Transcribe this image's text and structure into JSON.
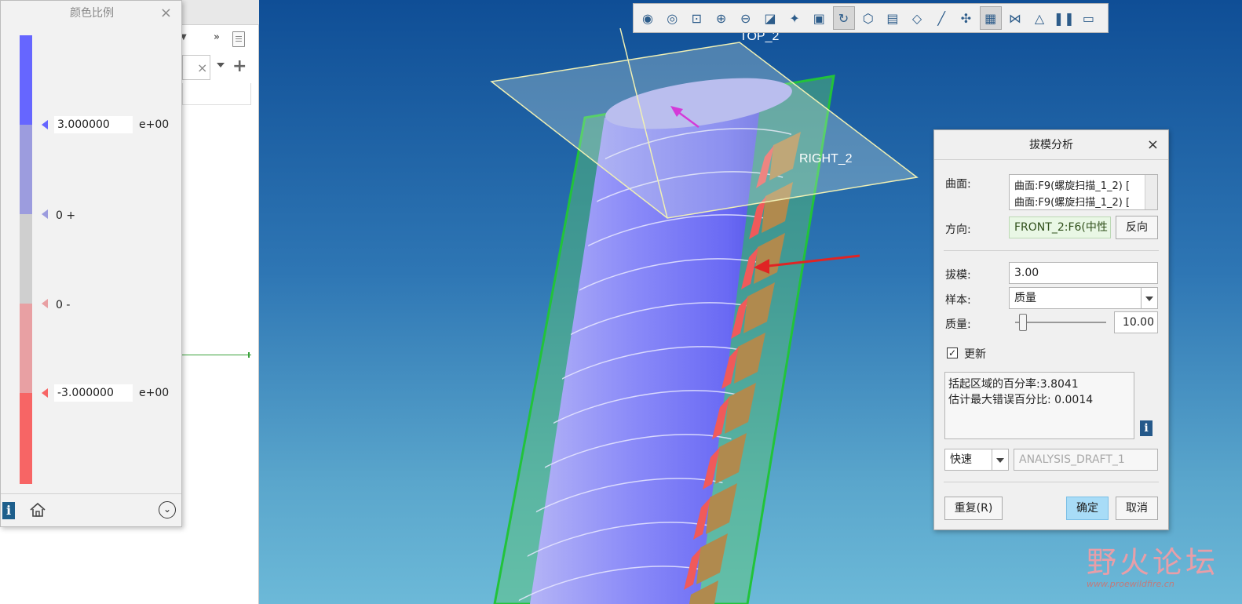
{
  "tree_panel": {
    "more_label": "»"
  },
  "color_scale": {
    "title": "颜色比例",
    "close": "×",
    "max_value": "3.000000",
    "max_exp": "e+00",
    "zero_plus": "0 +",
    "zero_minus": "0 -",
    "min_value": "-3.000000",
    "min_exp": "e+00",
    "colors": {
      "blue_dark": "#6666ff",
      "blue_light": "#9c9cde",
      "gray": "#cfcfcf",
      "red_light": "#e8a0a3",
      "red": "#f76565"
    }
  },
  "toolbar": {
    "icons": [
      "eye-icon",
      "eye-settings-icon",
      "zoom-window-icon",
      "zoom-in-icon",
      "zoom-out-icon",
      "refit-icon",
      "orient-icon",
      "display-style-icon",
      "view-manager-icon",
      "saved-views-icon",
      "named-views-icon",
      "perspective-icon",
      "datum-display-icon",
      "annotation-display-icon",
      "spin-center-icon",
      "repaint-icon",
      "model-tree-toggle-icon",
      "section-icon",
      "pause-icon",
      "more-icon"
    ]
  },
  "viewport": {
    "datum_top": "TOP_2",
    "datum_right": "RIGHT_2"
  },
  "draft_dialog": {
    "title": "拔模分析",
    "close": "×",
    "surface_label": "曲面:",
    "surface_items": [
      "曲面:F9(螺旋扫描_1_2) [",
      "曲面:F9(螺旋扫描_1_2) ["
    ],
    "direction_label": "方向:",
    "direction_value": "FRONT_2:F6(中性",
    "flip_button": "反向",
    "draft_label": "拔模:",
    "draft_value": "3.00",
    "sample_label": "样本:",
    "sample_value": "质量",
    "quality_label": "质量:",
    "quality_value": "10.00",
    "quality_fraction": 0.1,
    "update_label": "更新",
    "update_checked": true,
    "result_lines": [
      "括起区域的百分率:3.8041",
      "估计最大错误百分比: 0.0014"
    ],
    "mode_value": "快速",
    "analysis_name": "ANALYSIS_DRAFT_1",
    "repeat_button": "重复(R)",
    "ok_button": "确定",
    "cancel_button": "取消"
  },
  "watermark": {
    "title": "野火论坛",
    "url": "www.proewildfire.cn"
  }
}
